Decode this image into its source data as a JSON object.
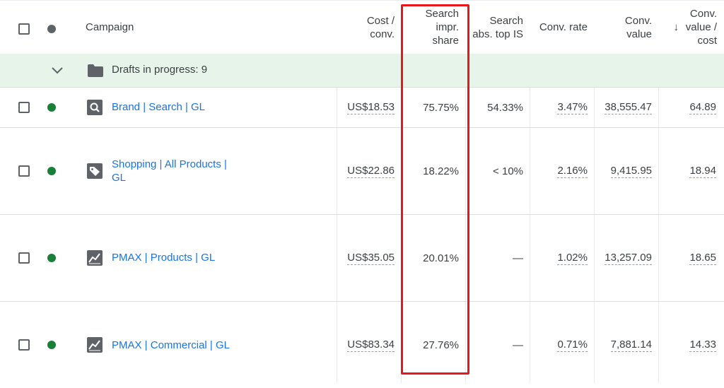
{
  "header": {
    "campaign": "Campaign",
    "cost_conv": "Cost / conv.",
    "search_impr_share": "Search impr. share",
    "search_abs_top_is": "Search abs. top IS",
    "conv_rate": "Conv. rate",
    "conv_value": "Conv. value",
    "conv_value_cost": "Conv. value / cost",
    "sort_arrow": "↓"
  },
  "drafts": {
    "label": "Drafts in progress: 9"
  },
  "colors": {
    "status_green": "#188038",
    "header_dot": "#5f6368",
    "link": "#1a73e8",
    "highlight": "#e8171c",
    "draft_bg": "#e6f4ea"
  },
  "rows": [
    {
      "icon": "search-icon",
      "name": "Brand | Search | GL",
      "cost_conv": "US$18.53",
      "search_impr_share": "75.75%",
      "search_abs_top_is": "54.33%",
      "conv_rate": "3.47%",
      "conv_value": "38,555.47",
      "conv_value_cost": "64.89"
    },
    {
      "icon": "tag-icon",
      "name": "Shopping | All Products | GL",
      "cost_conv": "US$22.86",
      "search_impr_share": "18.22%",
      "search_abs_top_is": "< 10%",
      "conv_rate": "2.16%",
      "conv_value": "9,415.95",
      "conv_value_cost": "18.94"
    },
    {
      "icon": "performance-max-icon",
      "name": "PMAX | Products | GL",
      "cost_conv": "US$35.05",
      "search_impr_share": "20.01%",
      "search_abs_top_is": "—",
      "conv_rate": "1.02%",
      "conv_value": "13,257.09",
      "conv_value_cost": "18.65"
    },
    {
      "icon": "performance-max-icon",
      "name": "PMAX | Commercial | GL",
      "cost_conv": "US$83.34",
      "search_impr_share": "27.76%",
      "search_abs_top_is": "—",
      "conv_rate": "0.71%",
      "conv_value": "7,881.14",
      "conv_value_cost": "14.33"
    }
  ]
}
